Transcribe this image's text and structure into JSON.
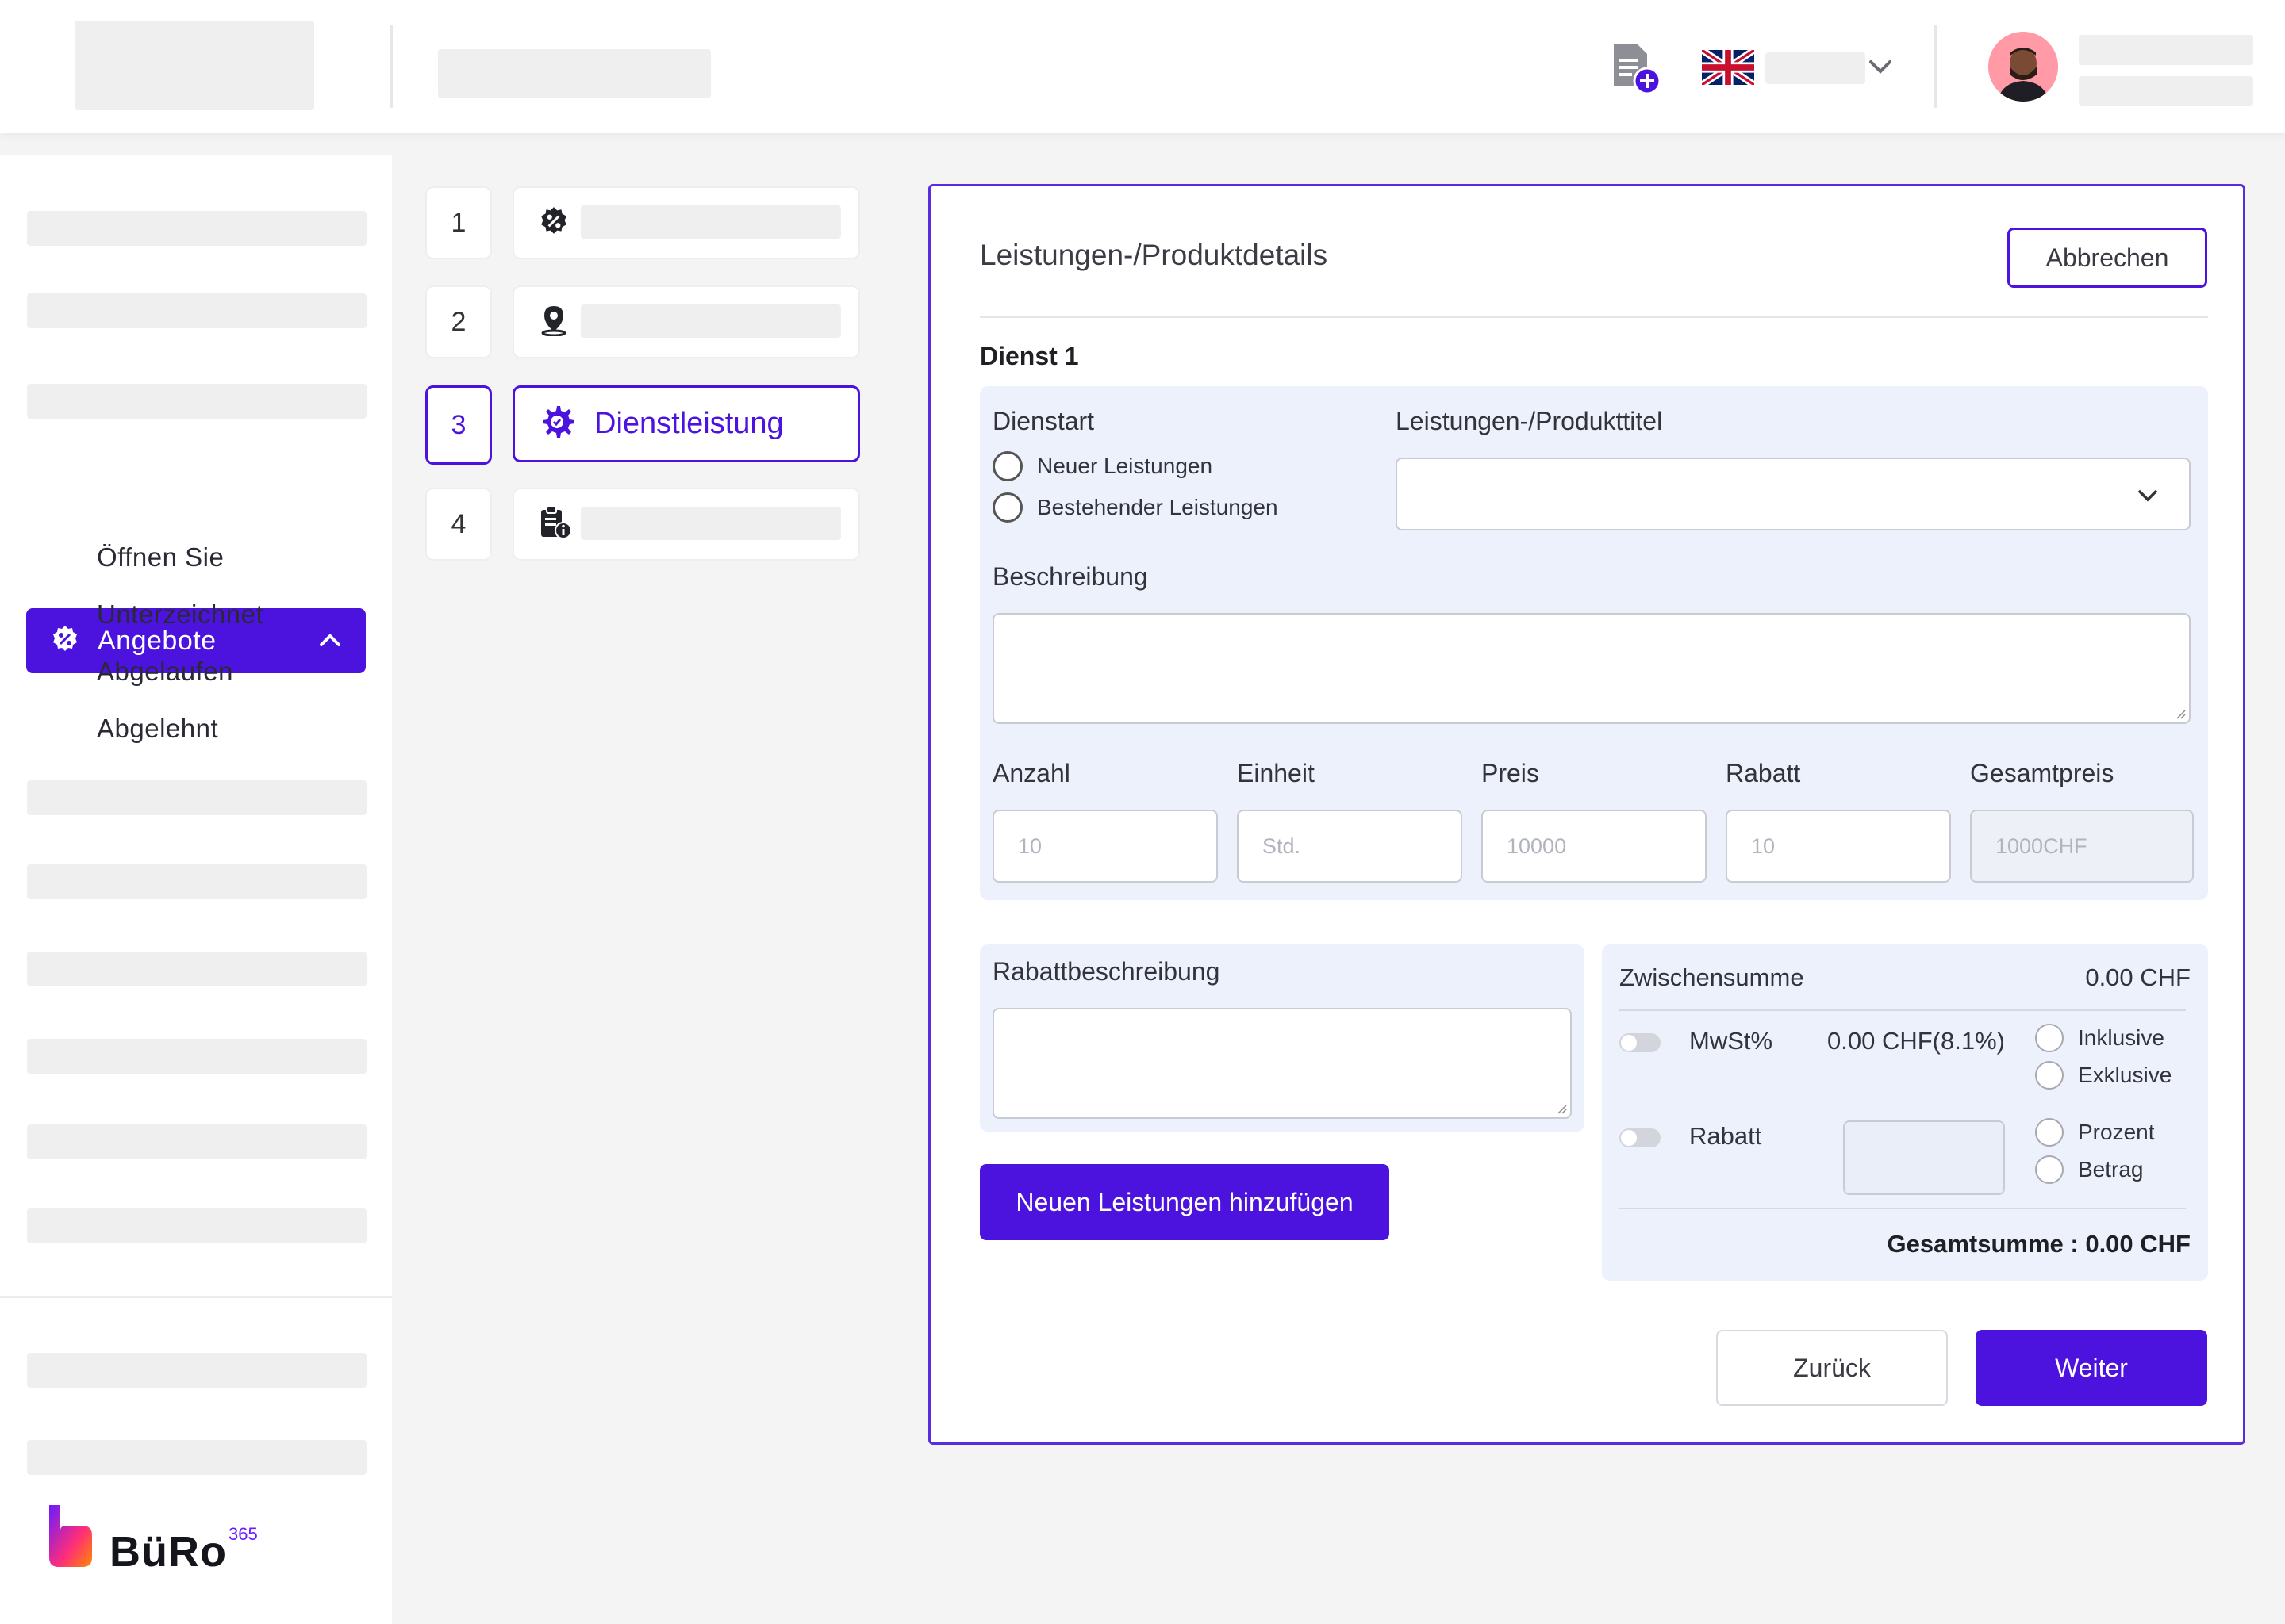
{
  "header": {
    "new_document_icon": "document-plus-icon",
    "language_flag": "uk-flag-icon",
    "colors": {
      "accent": "#4c13de"
    }
  },
  "sidebar": {
    "active_item": {
      "label": "Angebote",
      "icon": "percent-badge-icon"
    },
    "sub_items": [
      "Öffnen Sie",
      "Unterzeichnet",
      "Abgelaufen",
      "Abgelehnt"
    ],
    "brand": {
      "name": "BüRo",
      "superscript": "365"
    }
  },
  "stepper": {
    "steps": [
      {
        "number": "1",
        "icon": "percent-badge-icon",
        "label": ""
      },
      {
        "number": "2",
        "icon": "location-pin-icon",
        "label": ""
      },
      {
        "number": "3",
        "icon": "gear-icon",
        "label": "Dienstleistung"
      },
      {
        "number": "4",
        "icon": "clipboard-info-icon",
        "label": ""
      }
    ]
  },
  "form": {
    "title": "Leistungen-/Produktdetails",
    "cancel_label": "Abbrechen",
    "service_title": "Dienst 1",
    "service_type_label": "Dienstart",
    "radio_new": "Neuer Leistungen",
    "radio_existing": "Bestehender Leistungen",
    "product_title_label": "Leistungen-/Produkttitel",
    "description_label": "Beschreibung",
    "quantity_label": "Anzahl",
    "quantity_placeholder": "10",
    "unit_label": "Einheit",
    "unit_placeholder": "Std.",
    "price_label": "Preis",
    "price_placeholder": "10000",
    "discount_label": "Rabatt",
    "discount_placeholder": "10",
    "total_label": "Gesamtpreis",
    "total_value": "1000CHF",
    "discount_description_label": "Rabattbeschreibung",
    "add_service_label": "Neuen Leistungen hinzufügen"
  },
  "summary": {
    "subtotal_label": "Zwischensumme",
    "subtotal_value": "0.00 CHF",
    "vat_label": "MwSt%",
    "vat_value": "0.00 CHF(8.1%)",
    "inclusive_label": "Inklusive",
    "exclusive_label": "Exklusive",
    "discount_label": "Rabatt",
    "percent_label": "Prozent",
    "amount_label": "Betrag",
    "grand_total": "Gesamtsumme : 0.00 CHF"
  },
  "footer": {
    "back_label": "Zurück",
    "next_label": "Weiter"
  }
}
